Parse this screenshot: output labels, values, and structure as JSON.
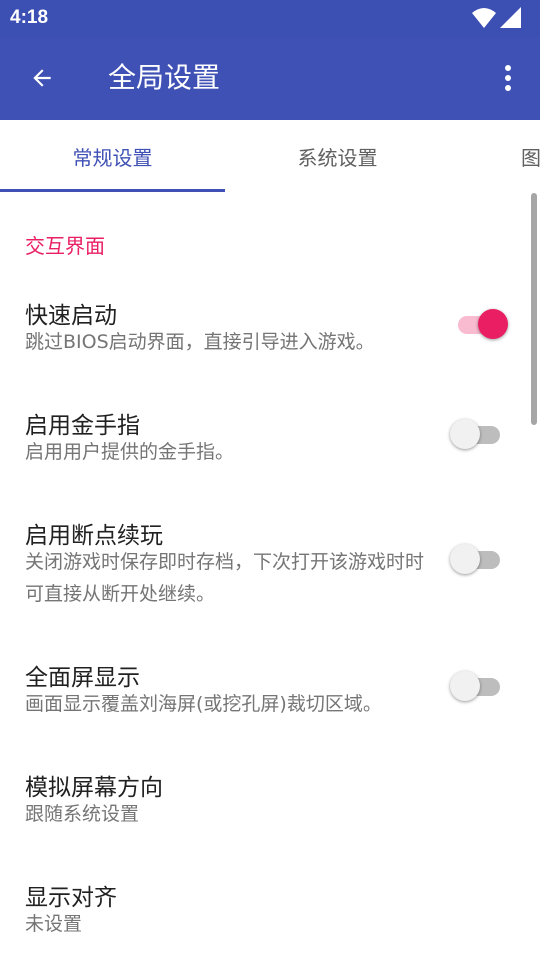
{
  "status_bar": {
    "time": "4:18"
  },
  "toolbar": {
    "title": "全局设置"
  },
  "tabs": [
    {
      "label": "常规设置",
      "active": true
    },
    {
      "label": "系统设置",
      "active": false
    },
    {
      "label": "图",
      "active": false
    }
  ],
  "section": {
    "title": "交互界面"
  },
  "prefs": [
    {
      "title": "快速启动",
      "summary": "跳过BIOS启动界面，直接引导进入游戏。",
      "enabled": true
    },
    {
      "title": "启用金手指",
      "summary": "启用用户提供的金手指。",
      "enabled": false
    },
    {
      "title": "启用断点续玩",
      "summary": "关闭游戏时保存即时存档，下次打开该游戏时时可直接从断开处继续。",
      "enabled": false
    },
    {
      "title": "全面屏显示",
      "summary": "画面显示覆盖刘海屏(或挖孔屏)裁切区域。",
      "enabled": false
    },
    {
      "title": "模拟屏幕方向",
      "summary": "跟随系统设置"
    },
    {
      "title": "显示对齐",
      "summary": "未设置"
    }
  ],
  "colors": {
    "primary": "#3f51b5",
    "status_bar": "#3c4fb2",
    "accent": "#e91e63",
    "switch_on_track": "#f8bbd0"
  },
  "icons": {
    "back": "arrow-back-icon",
    "more": "more-vert-icon",
    "wifi": "wifi-icon",
    "signal": "signal-icon"
  }
}
